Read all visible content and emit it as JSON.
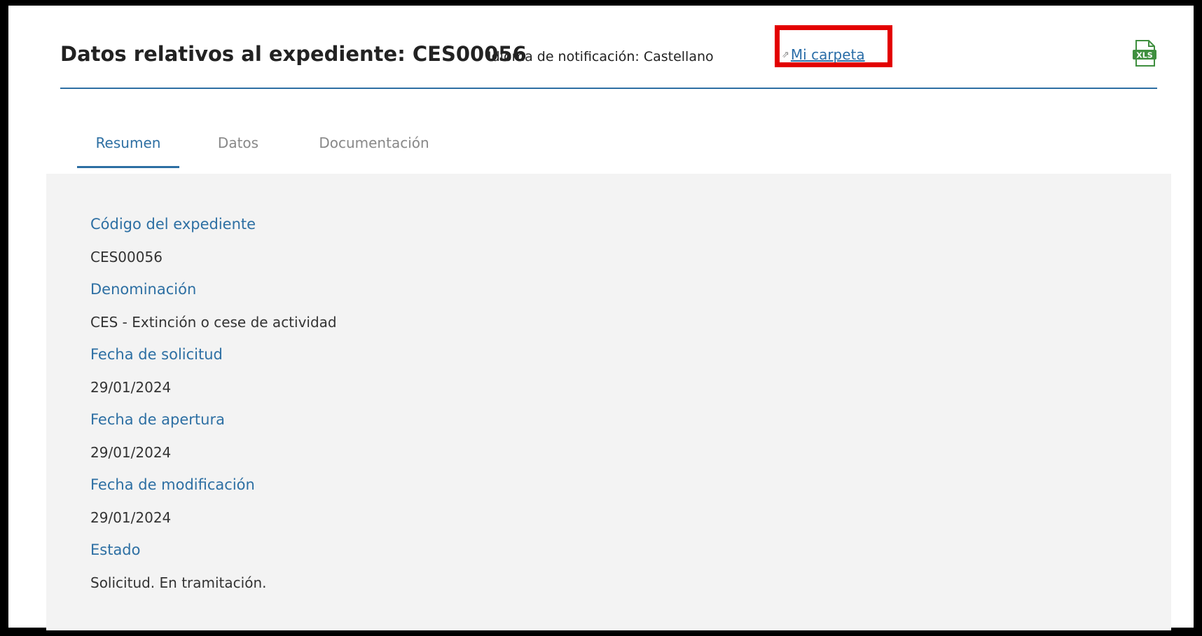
{
  "header": {
    "title": "Datos relativos al expediente: CES00056",
    "language_text": "Idioma de notificación: Castellano",
    "link_label": "Mi carpeta",
    "link_icon": "external-link-icon",
    "export_icon": "xls-export-icon",
    "highlight_color": "#e30000",
    "accent_color": "#2d6fa3"
  },
  "tabs": [
    {
      "label": "Resumen",
      "active": true
    },
    {
      "label": "Datos",
      "active": false
    },
    {
      "label": "Documentación",
      "active": false
    }
  ],
  "summary": [
    {
      "label": "Código del expediente",
      "value": "CES00056"
    },
    {
      "label": "Denominación",
      "value": "CES - Extinción o cese de actividad"
    },
    {
      "label": "Fecha de solicitud",
      "value": "29/01/2024"
    },
    {
      "label": "Fecha de apertura",
      "value": "29/01/2024"
    },
    {
      "label": "Fecha de modificación",
      "value": "29/01/2024"
    },
    {
      "label": "Estado",
      "value": "Solicitud. En tramitación."
    }
  ]
}
